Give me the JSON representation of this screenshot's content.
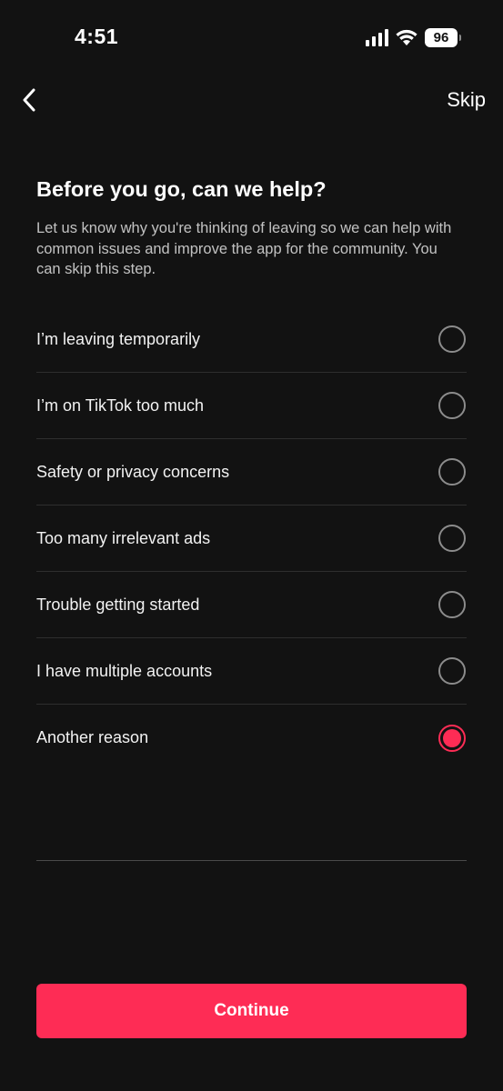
{
  "status_bar": {
    "time": "4:51",
    "battery": "96",
    "icons": [
      "cellular-signal-icon",
      "wifi-icon",
      "battery-icon"
    ]
  },
  "nav": {
    "back_icon": "chevron-left-icon",
    "skip_label": "Skip"
  },
  "header": {
    "title": "Before you go, can we help?",
    "description": "Let us know why you're thinking of leaving so we can help with common issues and improve the app for the community. You can skip this step."
  },
  "options": [
    {
      "label": "I’m leaving temporarily",
      "selected": false
    },
    {
      "label": "I’m on TikTok too much",
      "selected": false
    },
    {
      "label": "Safety or privacy concerns",
      "selected": false
    },
    {
      "label": "Too many irrelevant ads",
      "selected": false
    },
    {
      "label": "Trouble getting started",
      "selected": false
    },
    {
      "label": "I have multiple accounts",
      "selected": false
    },
    {
      "label": "Another reason",
      "selected": true
    }
  ],
  "reason_text": "",
  "continue_label": "Continue",
  "colors": {
    "background": "#121212",
    "accent": "#fe2c55",
    "divider": "#2e2e2e",
    "muted_text": "#c2c2c2"
  }
}
